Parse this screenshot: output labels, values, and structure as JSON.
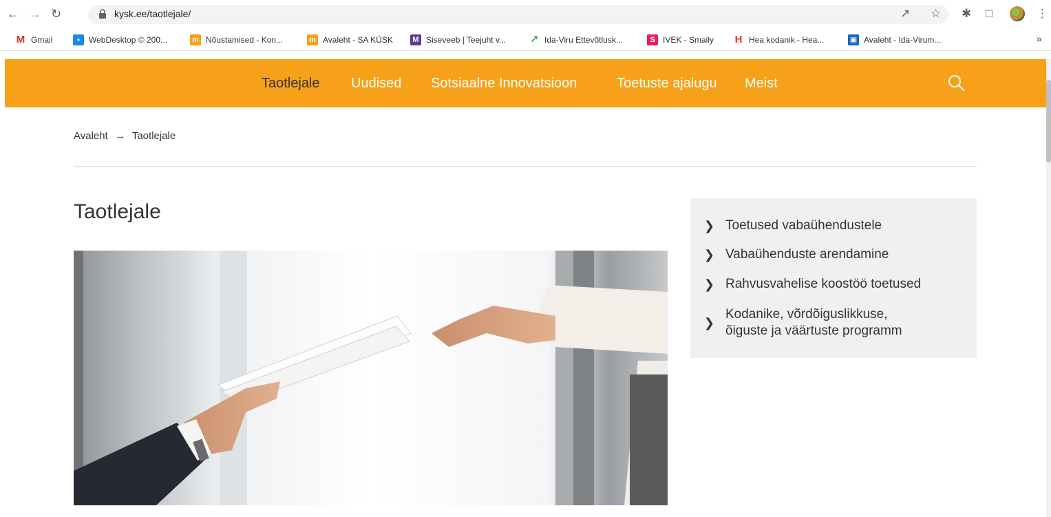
{
  "browser": {
    "url": "kysk.ee/taotlejale/",
    "bookmarks": [
      {
        "label": "Gmail",
        "icon": "gmail-icon",
        "color": "#d93025"
      },
      {
        "label": "WebDesktop © 200...",
        "icon": "webdesktop-icon",
        "color": "#1e88e5"
      },
      {
        "label": "Nõustamised - Kon...",
        "icon": "kusk-icon",
        "color": "#f7a01a"
      },
      {
        "label": "Avaleht - SA KÜSK",
        "icon": "kusk-icon",
        "color": "#f7a01a"
      },
      {
        "label": "Siseveeb | Teejuht v...",
        "icon": "siseveeb-icon",
        "color": "#5c3d99"
      },
      {
        "label": "Ida-Viru Ettevõtlusk...",
        "icon": "ida-viru-icon",
        "color": "#43a047"
      },
      {
        "label": "IVEK - Smaily",
        "icon": "smaily-icon",
        "color": "#e91e63"
      },
      {
        "label": "Hea kodanik - Hea...",
        "icon": "hea-kodanik-icon",
        "color": "#e53935"
      },
      {
        "label": "Avaleht - Ida-Virum...",
        "icon": "ida-virumaa-icon",
        "color": "#1565c0"
      }
    ],
    "more": "»"
  },
  "nav": {
    "items": [
      "Taotlejale",
      "Uudised",
      "Sotsiaalne Innovatsioon",
      "Toetuste ajalugu",
      "Meist"
    ],
    "active_index": 0,
    "accent": "#f7a01a"
  },
  "breadcrumb": {
    "home": "Avaleht",
    "separator": "→",
    "current": "Taotlejale"
  },
  "page": {
    "title": "Taotlejale"
  },
  "side_menu": {
    "items": [
      {
        "label": "Toetused vabaühendustele"
      },
      {
        "label": "Vabaühenduste arendamine"
      },
      {
        "label": "Rahvusvahelise koostöö toetused"
      },
      {
        "label": "Kodanike, võrdõiguslikkuse,",
        "label2": "õiguste ja väärtuste programm"
      }
    ]
  }
}
